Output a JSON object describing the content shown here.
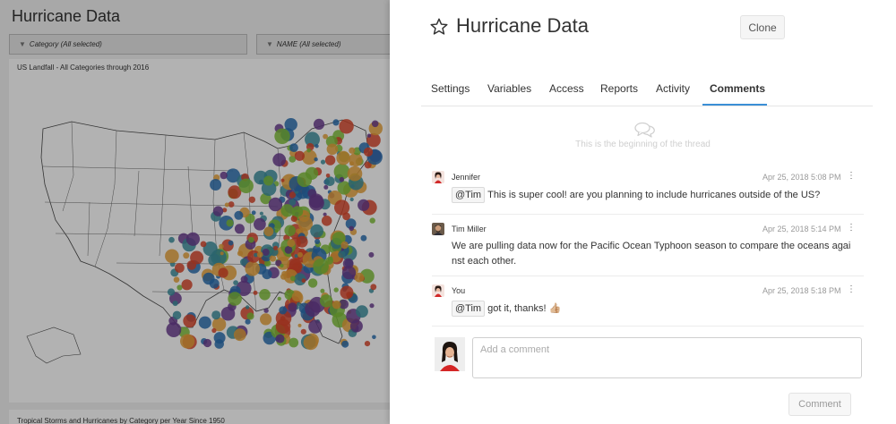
{
  "dashboard": {
    "title": "Hurricane Data",
    "filters": [
      {
        "label": "Category (All selected)"
      },
      {
        "label": "NAME (All selected)"
      }
    ],
    "map_title": "US Landfall - All Categories through 2016",
    "bottom_title": "Tropical Storms and Hurricanes by Category per Year Since 1950",
    "palette": [
      "#d9472b",
      "#3d8f9e",
      "#7fbf3a",
      "#e7a23b",
      "#6a3d8f",
      "#2a6fb0"
    ]
  },
  "panel": {
    "title": "Hurricane Data",
    "clone_label": "Clone",
    "tabs": [
      {
        "label": "Settings"
      },
      {
        "label": "Variables"
      },
      {
        "label": "Access"
      },
      {
        "label": "Reports"
      },
      {
        "label": "Activity"
      },
      {
        "label": "Comments",
        "active": true
      }
    ],
    "thread_start": "This is the beginning of the thread",
    "comments": [
      {
        "author": "Jennifer",
        "time": "Apr 25, 2018 5:08 PM",
        "mention": "@Tim",
        "text": "This is super cool! are you planning to include hurricanes outside of the US?"
      },
      {
        "author": "Tim Miller",
        "time": "Apr 25, 2018 5:14 PM",
        "text": "We are pulling data now for the Pacific Ocean Typhoon season to compare the oceans agai nst each other."
      },
      {
        "author": "You",
        "time": "Apr 25, 2018 5:18 PM",
        "mention": "@Tim",
        "text": "got it, thanks! 👍🏼"
      }
    ],
    "comment_placeholder": "Add a comment",
    "comment_button": "Comment",
    "accent_color": "#3a8fd6"
  }
}
